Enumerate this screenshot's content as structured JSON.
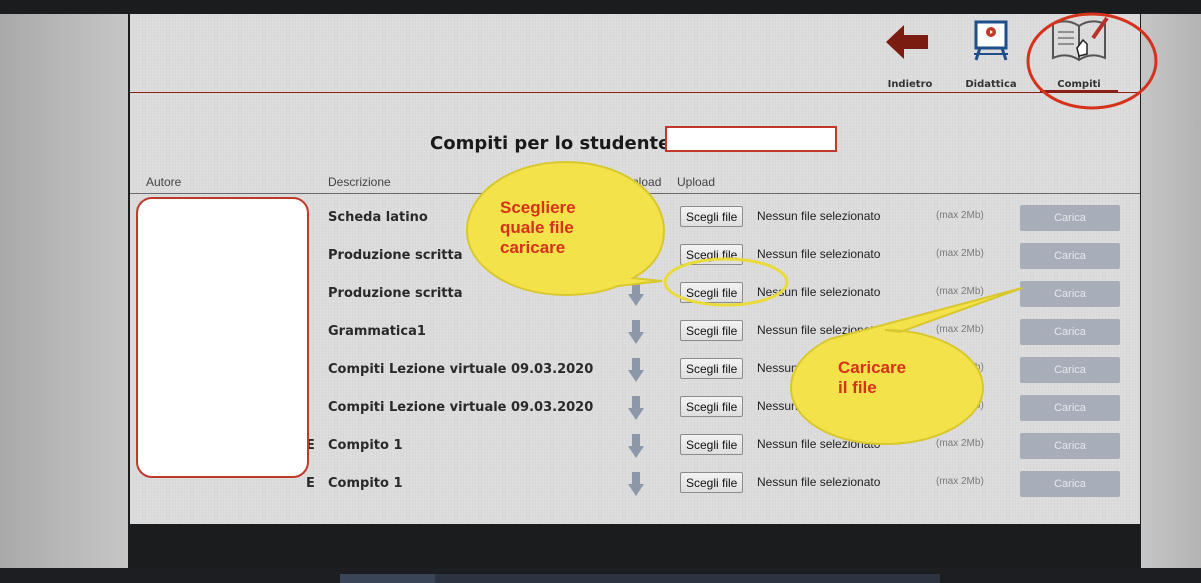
{
  "toolbar": {
    "items": [
      {
        "label": "Indietro",
        "icon": "back-arrow-icon"
      },
      {
        "label": "Didattica",
        "icon": "presentation-board-icon"
      },
      {
        "label": "Compiti",
        "icon": "notebook-pen-icon"
      }
    ]
  },
  "page": {
    "title": "Compiti per lo studente"
  },
  "table": {
    "headers": {
      "autore": "Autore",
      "descrizione": "Descrizione",
      "download": "Download",
      "upload": "Upload"
    },
    "rows": [
      {
        "description": "Scheda latino",
        "file_button": "Scegli file",
        "file_status": "Nessun file selezionato",
        "max": "(max 2Mb)",
        "upload": "Carica"
      },
      {
        "description": "Produzione scritta",
        "file_button": "Scegli file",
        "file_status": "Nessun file selezionato",
        "max": "(max 2Mb)",
        "upload": "Carica"
      },
      {
        "description": "Produzione scritta",
        "file_button": "Scegli file",
        "file_status": "Nessun file selezionato",
        "max": "(max 2Mb)",
        "upload": "Carica"
      },
      {
        "description": "Grammatica1",
        "file_button": "Scegli file",
        "file_status": "Nessun file selezionato",
        "max": "(max 2Mb)",
        "upload": "Carica"
      },
      {
        "description": "Compiti Lezione virtuale 09.03.2020",
        "file_button": "Scegli file",
        "file_status": "Nessun file selezionato",
        "max": "(max 2Mb)",
        "upload": "Carica"
      },
      {
        "description": "Compiti Lezione virtuale 09.03.2020",
        "file_button": "Scegli file",
        "file_status": "Nessun file selezionato",
        "max": "(max 2Mb)",
        "upload": "Carica"
      },
      {
        "description": "Compito 1",
        "file_button": "Scegli file",
        "file_status": "Nessun file selezionato",
        "max": "(max 2Mb)",
        "upload": "Carica",
        "author_tail": "E"
      },
      {
        "description": "Compito 1",
        "file_button": "Scegli file",
        "file_status": "Nessun file selezionato",
        "max": "(max 2Mb)",
        "upload": "Carica",
        "author_tail": "E"
      }
    ]
  },
  "annotations": {
    "bubble1": "Scegliere\nquale file\ncaricare",
    "bubble2": "Caricare\nil file"
  },
  "colors": {
    "accent": "#8a1f14",
    "highlight": "#f3e24a",
    "annotation_text": "#d6311b",
    "redaction_border": "#c0392b",
    "upload_button": "#a7aeb9"
  }
}
